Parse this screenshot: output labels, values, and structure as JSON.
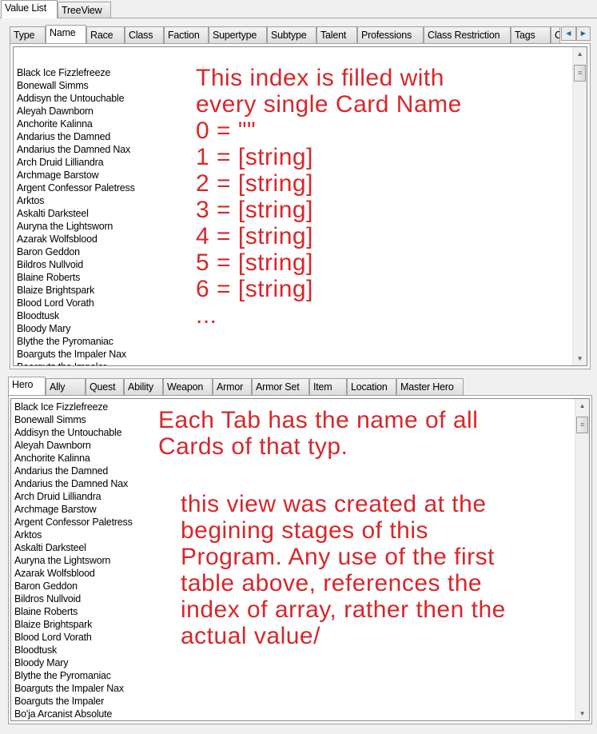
{
  "top_tabs": [
    {
      "label": "Value List"
    },
    {
      "label": "TreeView"
    }
  ],
  "field_tabs": [
    {
      "label": "Type"
    },
    {
      "label": "Name"
    },
    {
      "label": "Race"
    },
    {
      "label": "Class"
    },
    {
      "label": "Faction"
    },
    {
      "label": "Supertype"
    },
    {
      "label": "Subtype"
    },
    {
      "label": "Talent"
    },
    {
      "label": "Professions"
    },
    {
      "label": "Class Restriction"
    },
    {
      "label": "Tags"
    },
    {
      "label": "C"
    }
  ],
  "field_tabs_active": "Name",
  "name_list": [
    "",
    "Black Ice Fizzlefreeze",
    "Bonewall Simms",
    "Addisyn the Untouchable",
    "Aleyah Dawnborn",
    "Anchorite Kalinna",
    "Andarius the Damned",
    "Andarius the Damned Nax",
    "Arch Druid Lilliandra",
    "Archmage Barstow",
    "Argent Confessor Paletress",
    "Arktos",
    "Askalti Darksteel",
    "Auryna the Lightsworn",
    "Azarak Wolfsblood",
    "Baron Geddon",
    "Bildros Nullvoid",
    "Blaine Roberts",
    "Blaize Brightspark",
    "Blood Lord Vorath",
    "Bloodtusk",
    "Bloody Mary",
    "Blythe the Pyromaniac",
    "Boarguts the Impaler Nax",
    "Boarguts the Impaler"
  ],
  "top_note": [
    "This index is filled with",
    "every single Card Name",
    "0 = \"\"",
    "1 = [string]",
    "2 = [string]",
    "3 = [string]",
    "4 = [string]",
    "5 = [string]",
    "6 = [string]",
    "..."
  ],
  "type_tabs": [
    {
      "label": "Hero"
    },
    {
      "label": "Ally"
    },
    {
      "label": "Quest"
    },
    {
      "label": "Ability"
    },
    {
      "label": "Weapon"
    },
    {
      "label": "Armor"
    },
    {
      "label": "Armor Set"
    },
    {
      "label": "Item"
    },
    {
      "label": "Location"
    },
    {
      "label": "Master Hero"
    }
  ],
  "type_tabs_active": "Hero",
  "hero_list": [
    "Black Ice Fizzlefreeze",
    "Bonewall Simms",
    "Addisyn the Untouchable",
    "Aleyah Dawnborn",
    "Anchorite Kalinna",
    "Andarius the Damned",
    "Andarius the Damned Nax",
    "Arch Druid Lilliandra",
    "Archmage Barstow",
    "Argent Confessor Paletress",
    "Arktos",
    "Askalti Darksteel",
    "Auryna the Lightsworn",
    "Azarak Wolfsblood",
    "Baron Geddon",
    "Bildros Nullvoid",
    "Blaine Roberts",
    "Blaize Brightspark",
    "Blood Lord Vorath",
    "Bloodtusk",
    "Bloody Mary",
    "Blythe the Pyromaniac",
    "Boarguts the Impaler Nax",
    "Boarguts the Impaler",
    "Bo'ja Arcanist Absolute"
  ],
  "bottom_note_1": [
    "Each Tab has the name of all",
    "Cards of that typ."
  ],
  "bottom_note_2": [
    "this view was created at the",
    "begining stages of this",
    "Program. Any use of the first",
    "table above, references the",
    "index of array, rather then the",
    "actual value/"
  ],
  "colors": {
    "annotation": "#d8262a"
  }
}
